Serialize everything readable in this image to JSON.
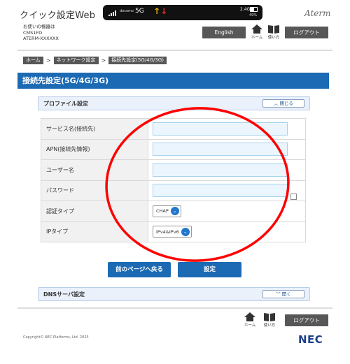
{
  "header": {
    "app_title": "クイック設定Web",
    "status": {
      "carrier": "docomo",
      "network": "5G",
      "speed": "2.4G",
      "battery_pct": "49%"
    },
    "brand": "Aterm",
    "device_label": "お使いの機器は",
    "device_model": "CMS1FD",
    "device_id": "ATERM-XXXXXX",
    "english_label": "English",
    "home_label": "ホーム",
    "guide_label": "使い方",
    "logout_label": "ログアウト"
  },
  "breadcrumb": [
    "ホーム",
    "ネットワーク設定",
    "接続先設定(5G/4G/3G)"
  ],
  "page_title": "接続先設定(5G/4G/3G)",
  "profile_section": {
    "title": "プロファイル設定",
    "toggle_label": "閉じる",
    "rows": [
      {
        "label": "サービス名(接続先)",
        "value": ""
      },
      {
        "label": "APN(接続先情報)",
        "value": ""
      },
      {
        "label": "ユーザー名",
        "value": ""
      },
      {
        "label": "パスワード",
        "value": ""
      },
      {
        "label": "認証タイプ",
        "value": "CHAP"
      },
      {
        "label": "IPタイプ",
        "value": "IPv4&IPv6"
      }
    ]
  },
  "buttons": {
    "back": "前のページへ戻る",
    "set": "設定"
  },
  "dns_section": {
    "title": "DNSサーバ設定",
    "toggle_label": "開く"
  },
  "footer": {
    "home_label": "ホーム",
    "guide_label": "使い方",
    "logout_label": "ログアウト",
    "copyright": "Copyright© NEC Platforms, Ltd. 2025",
    "logo": "NEC"
  },
  "colors": {
    "accent": "#1c6ab3",
    "annotation": "#ff0000"
  }
}
